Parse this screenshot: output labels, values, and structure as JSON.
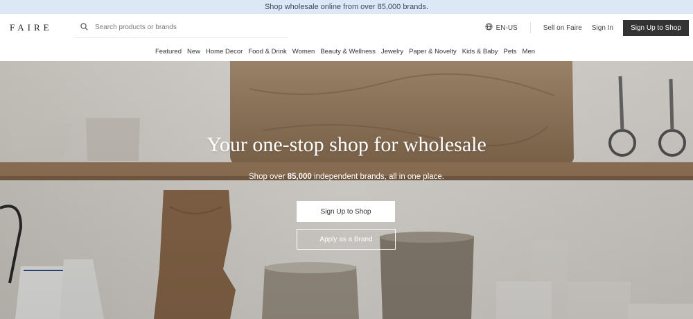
{
  "banner": {
    "text": "Shop wholesale online from over 85,000 brands."
  },
  "header": {
    "logo": "FAIRE",
    "search_placeholder": "Search products or brands",
    "language": "EN-US",
    "sell_link": "Sell on Faire",
    "signin_link": "Sign In",
    "signup_button": "Sign Up to Shop"
  },
  "nav": {
    "items": [
      "Featured",
      "New",
      "Home Decor",
      "Food & Drink",
      "Women",
      "Beauty & Wellness",
      "Jewelry",
      "Paper & Novelty",
      "Kids & Baby",
      "Pets",
      "Men"
    ]
  },
  "hero": {
    "title": "Your one-stop shop for wholesale",
    "subtitle_prefix": "Shop over ",
    "subtitle_bold": "85,000",
    "subtitle_suffix": " independent brands, all in one place.",
    "primary_button": "Sign Up to Shop",
    "secondary_button": "Apply as a Brand"
  },
  "colors": {
    "banner_bg": "#dde8f6",
    "signup_bg": "#333333",
    "accent_text": "#ffffff"
  },
  "icons": {
    "search": "search-icon",
    "globe": "globe-icon"
  }
}
